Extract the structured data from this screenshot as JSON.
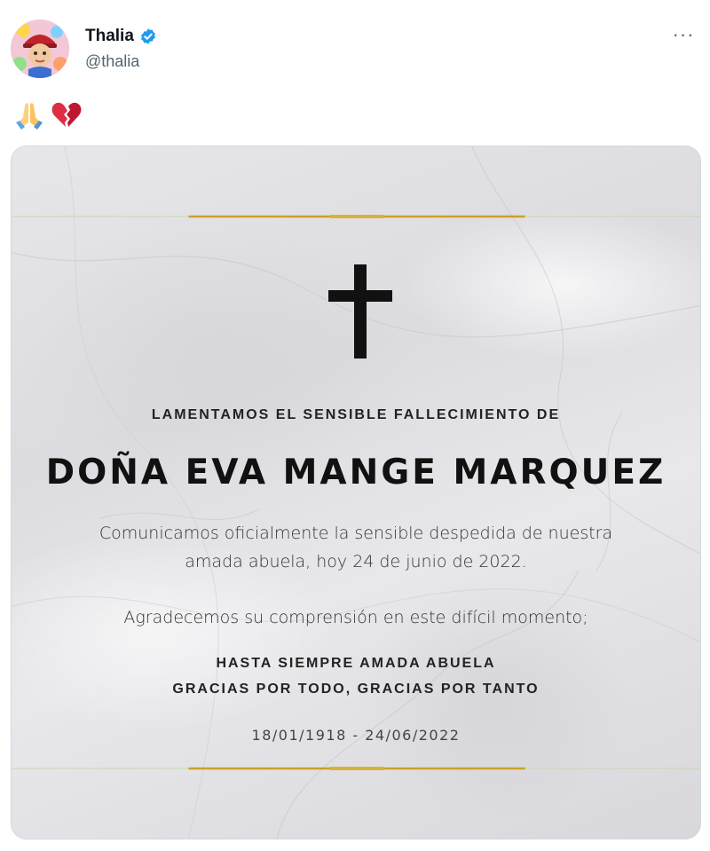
{
  "author": {
    "display_name": "Thalia",
    "handle": "@thalia",
    "verified": true,
    "verified_color": "#1d9bf0",
    "avatar_icon": "avatar-photo"
  },
  "more_icon_label": "···",
  "tweet": {
    "emojis": [
      "folded-hands-icon",
      "broken-heart-icon"
    ]
  },
  "media_card": {
    "lead_line": "LAMENTAMOS EL SENSIBLE FALLECIMIENTO DE",
    "name": "DOÑA EVA MANGE MARQUEZ",
    "body_line_1": "Comunicamos oficialmente la sensible despedida de nuestra",
    "body_line_2": "amada abuela, hoy 24 de junio de 2022.",
    "body_line_3": "Agradecemos su comprensión en este difícil momento;",
    "closing_line_1": "HASTA SIEMPRE AMADA ABUELA",
    "closing_line_2": "GRACIAS POR TODO, GRACIAS POR TANTO",
    "dates": "18/01/1918 - 24/06/2022",
    "accent_gold": "#c9a227",
    "icon": "cross-icon"
  }
}
